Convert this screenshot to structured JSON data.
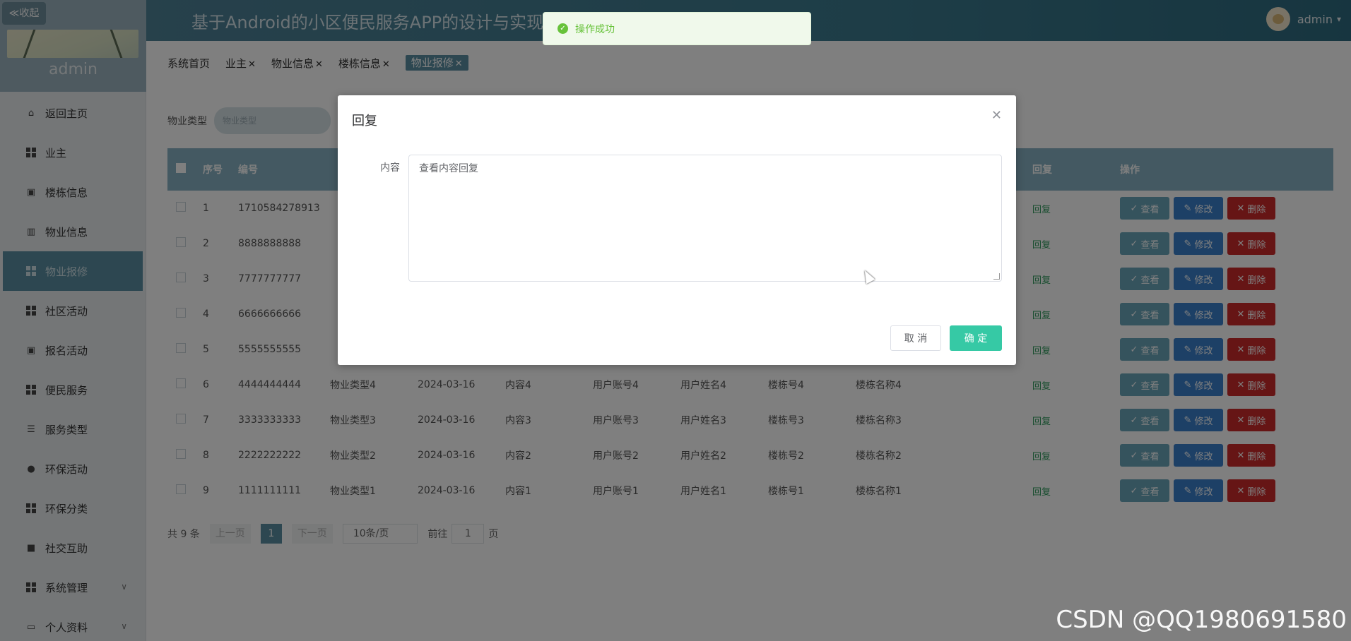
{
  "sidebar": {
    "collapse_label": "≪收起",
    "username": "admin",
    "items": [
      {
        "label": "返回主页",
        "icon": "home-icon"
      },
      {
        "label": "业主",
        "icon": "grid-icon"
      },
      {
        "label": "楼栋信息",
        "icon": "clipboard-icon"
      },
      {
        "label": "物业信息",
        "icon": "chart-icon"
      },
      {
        "label": "物业报修",
        "icon": "grid-icon",
        "active": true
      },
      {
        "label": "社区活动",
        "icon": "grid-icon"
      },
      {
        "label": "报名活动",
        "icon": "clipboard-icon"
      },
      {
        "label": "便民服务",
        "icon": "grid-icon"
      },
      {
        "label": "服务类型",
        "icon": "list-icon"
      },
      {
        "label": "环保活动",
        "icon": "leaf-icon"
      },
      {
        "label": "环保分类",
        "icon": "grid-icon"
      },
      {
        "label": "社交互助",
        "icon": "book-icon"
      },
      {
        "label": "系统管理",
        "icon": "grid-icon",
        "has_children": true
      },
      {
        "label": "个人资料",
        "icon": "card-icon",
        "has_children": true
      }
    ]
  },
  "header": {
    "title": "基于Android的小区便民服务APP的设计与实现",
    "user": "admin"
  },
  "tags": [
    {
      "label": "系统首页",
      "closable": false
    },
    {
      "label": "业主",
      "closable": true
    },
    {
      "label": "物业信息",
      "closable": true
    },
    {
      "label": "楼栋信息",
      "closable": true
    },
    {
      "label": "物业报修",
      "closable": true,
      "active": true
    }
  ],
  "filter": {
    "label": "物业类型",
    "placeholder": "物业类型"
  },
  "table": {
    "headers": {
      "seq": "序号",
      "no": "编号",
      "reply": "回复",
      "op": "操作"
    },
    "rows": [
      {
        "seq": "1",
        "no": "1710584278913",
        "type": "",
        "date": "",
        "content": "",
        "acct": "",
        "name": "",
        "bno": "",
        "bname": "",
        "reply": "回复"
      },
      {
        "seq": "2",
        "no": "8888888888",
        "type": "",
        "date": "",
        "content": "",
        "acct": "",
        "name": "",
        "bno": "",
        "bname": "",
        "reply": "回复"
      },
      {
        "seq": "3",
        "no": "7777777777",
        "type": "",
        "date": "",
        "content": "",
        "acct": "",
        "name": "",
        "bno": "",
        "bname": "",
        "reply": "回复"
      },
      {
        "seq": "4",
        "no": "6666666666",
        "type": "",
        "date": "",
        "content": "",
        "acct": "",
        "name": "",
        "bno": "",
        "bname": "",
        "reply": "回复"
      },
      {
        "seq": "5",
        "no": "5555555555",
        "type": "",
        "date": "",
        "content": "",
        "acct": "",
        "name": "",
        "bno": "",
        "bname": "",
        "reply": "回复"
      },
      {
        "seq": "6",
        "no": "4444444444",
        "type": "物业类型4",
        "date": "2024-03-16",
        "content": "内容4",
        "acct": "用户账号4",
        "name": "用户姓名4",
        "bno": "楼栋号4",
        "bname": "楼栋名称4",
        "reply": "回复"
      },
      {
        "seq": "7",
        "no": "3333333333",
        "type": "物业类型3",
        "date": "2024-03-16",
        "content": "内容3",
        "acct": "用户账号3",
        "name": "用户姓名3",
        "bno": "楼栋号3",
        "bname": "楼栋名称3",
        "reply": "回复"
      },
      {
        "seq": "8",
        "no": "2222222222",
        "type": "物业类型2",
        "date": "2024-03-16",
        "content": "内容2",
        "acct": "用户账号2",
        "name": "用户姓名2",
        "bno": "楼栋号2",
        "bname": "楼栋名称2",
        "reply": "回复"
      },
      {
        "seq": "9",
        "no": "1111111111",
        "type": "物业类型1",
        "date": "2024-03-16",
        "content": "内容1",
        "acct": "用户账号1",
        "name": "用户姓名1",
        "bno": "楼栋号1",
        "bname": "楼栋名称1",
        "reply": "回复"
      }
    ],
    "actions": {
      "view": "查看",
      "edit": "修改",
      "delete": "删除"
    }
  },
  "pagination": {
    "total": "共 9 条",
    "prev": "上一页",
    "current": "1",
    "next": "下一页",
    "page_size": "10条/页",
    "goto_label": "前往",
    "goto_value": "1",
    "page_suffix": "页"
  },
  "toast": {
    "message": "操作成功",
    "color": "#67c23a"
  },
  "dialog": {
    "title": "回复",
    "field_label": "内容",
    "field_value": "查看内容回复",
    "cancel": "取 消",
    "confirm": "确 定"
  },
  "watermark": "CSDN @QQ1980691580",
  "colors": {
    "accent": "#5a8fa3",
    "confirm": "#36c9a5",
    "edit": "#3b80cc",
    "delete": "#cc2a2a"
  }
}
